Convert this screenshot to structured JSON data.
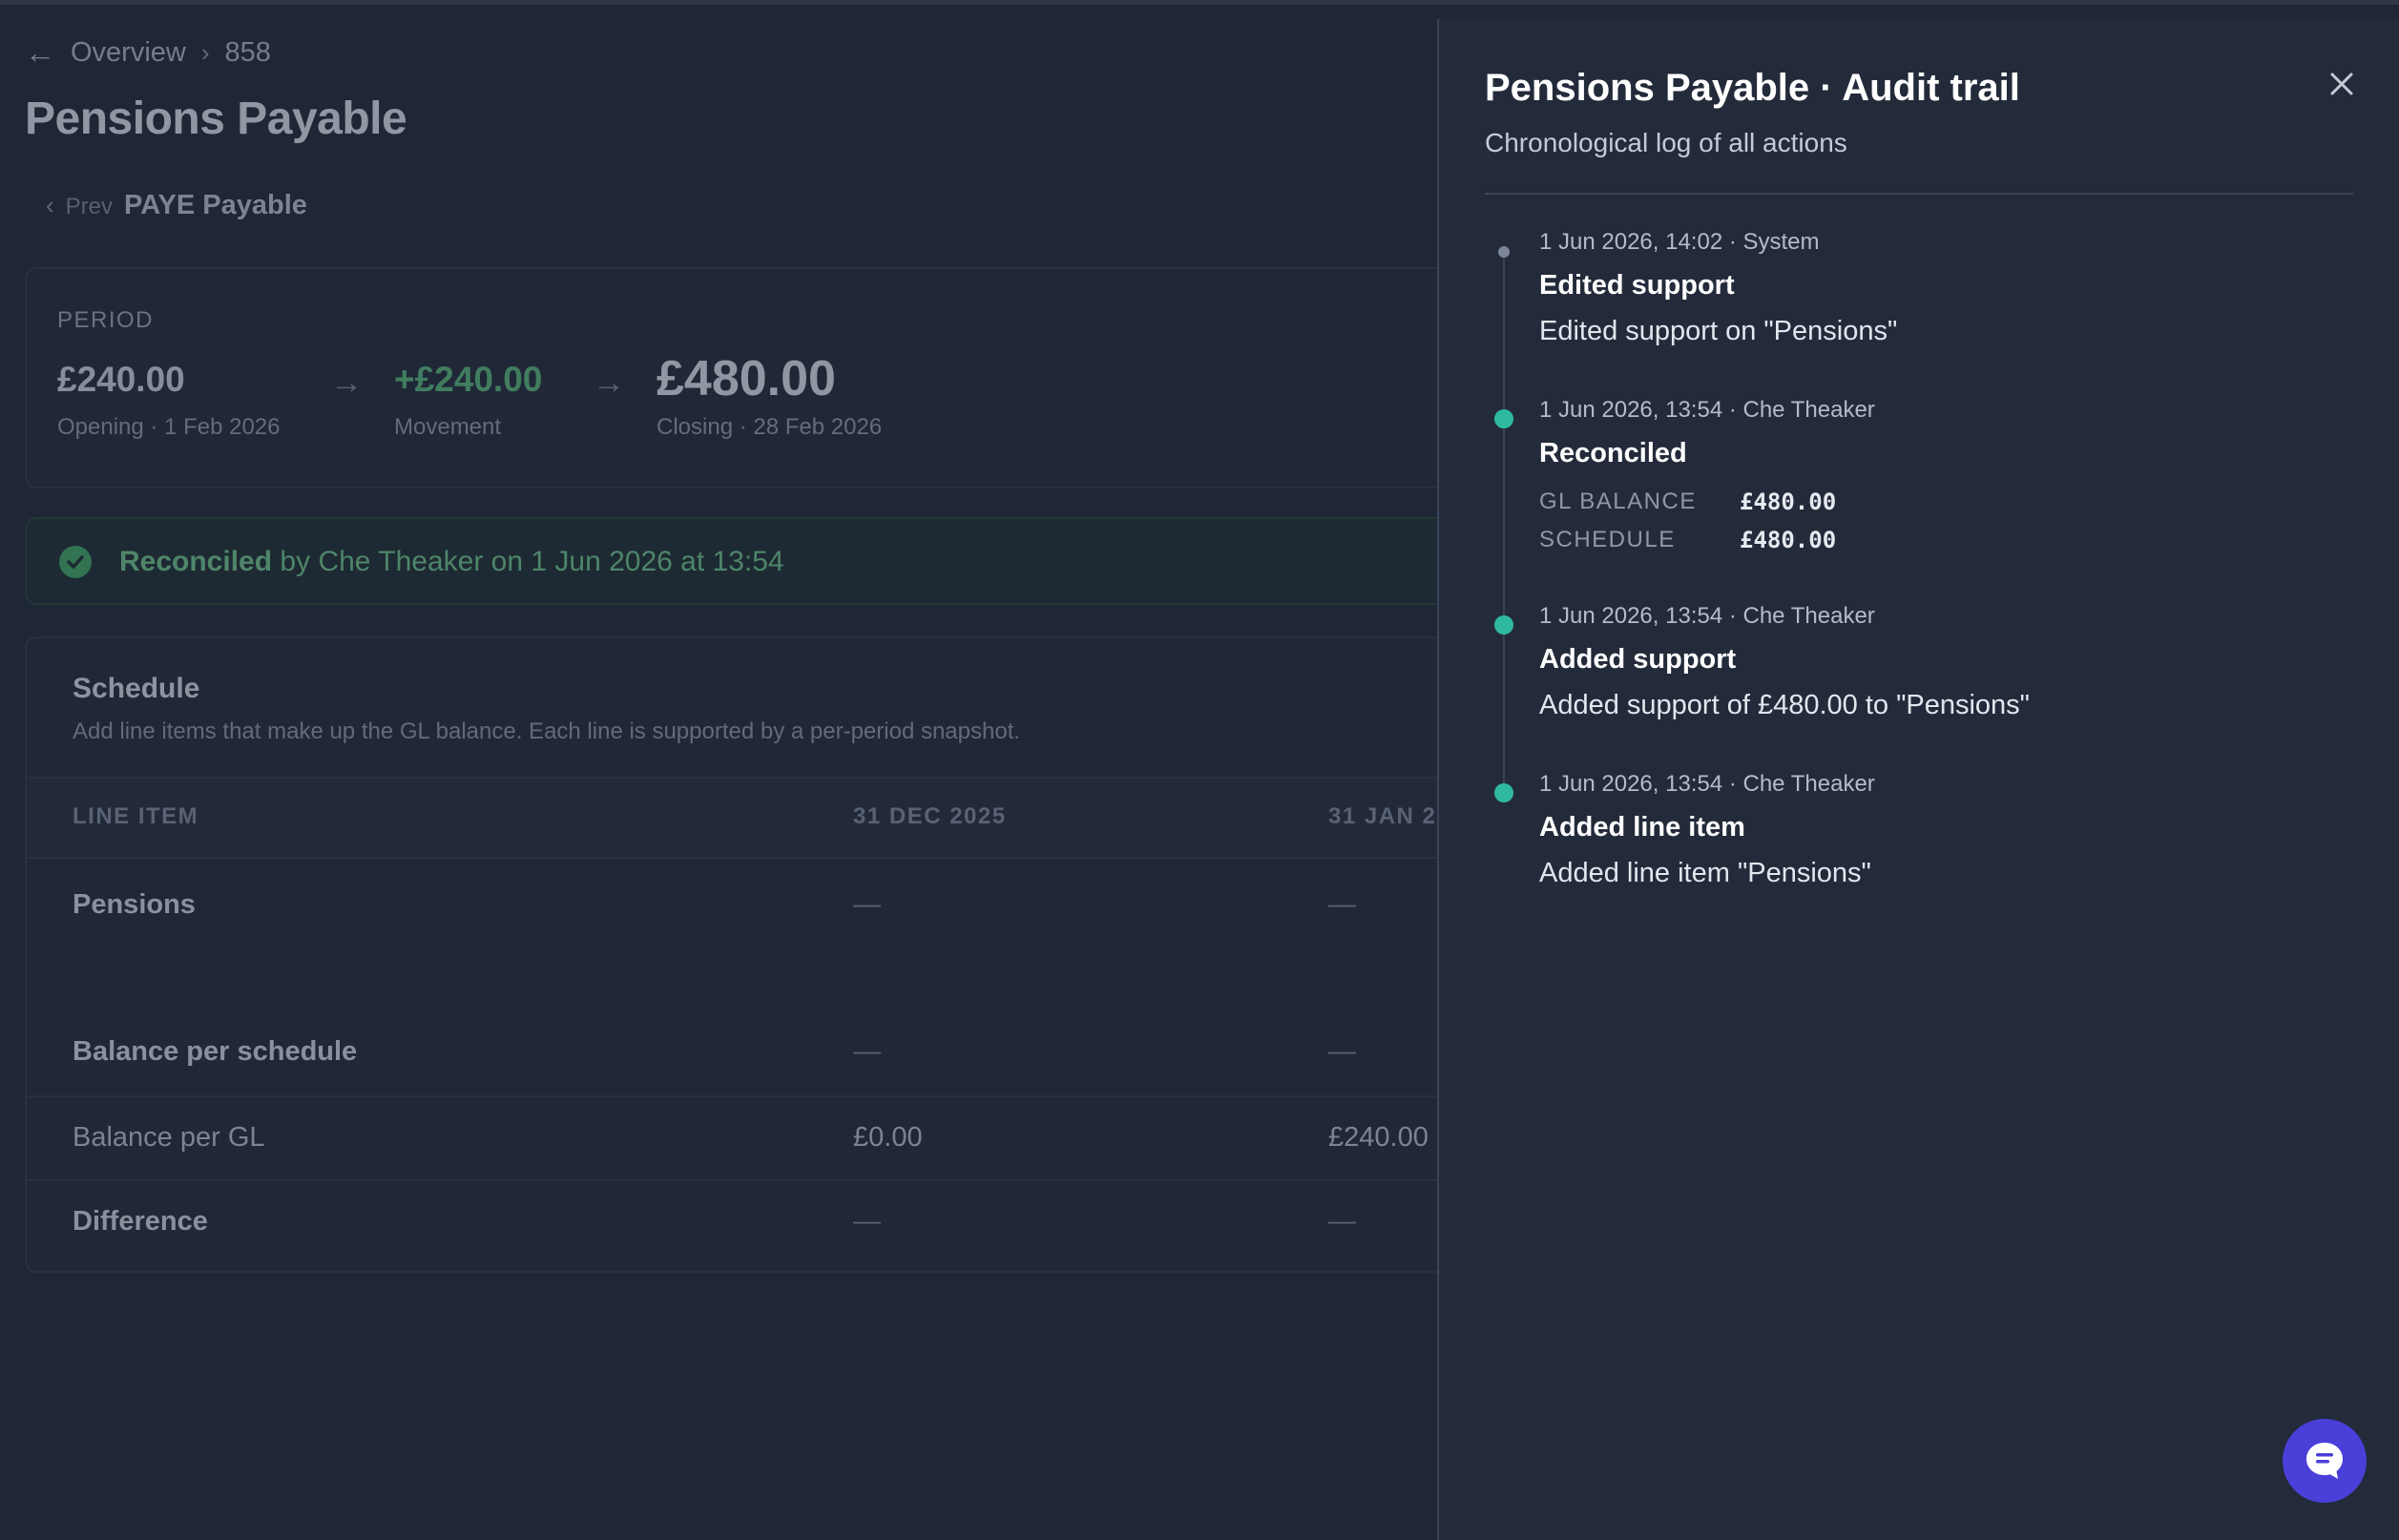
{
  "breadcrumb": {
    "back": "Overview",
    "current": "858"
  },
  "page_title": "Pensions Payable",
  "prev_nav": {
    "label": "Prev",
    "name": "PAYE Payable"
  },
  "period": {
    "label": "PERIOD",
    "opening_value": "£240.00",
    "opening_label": "Opening · 1 Feb 2026",
    "movement_value": "+£240.00",
    "movement_label": "Movement",
    "closing_value": "£480.00",
    "closing_label": "Closing · 28 Feb 2026"
  },
  "reconciled_banner": {
    "status": "Reconciled",
    "by_prefix": "by",
    "user": "Che Theaker",
    "on_text": "on 1 Jun 2026 at 13:54"
  },
  "schedule": {
    "title": "Schedule",
    "subtitle": "Add line items that make up the GL balance. Each line is supported by a per-period snapshot.",
    "columns": [
      "LINE ITEM",
      "31 DEC 2025",
      "31 JAN 2"
    ],
    "rows": [
      {
        "label": "Pensions",
        "c1": "—",
        "c2": "—"
      },
      {
        "label": "Balance per schedule",
        "c1": "—",
        "c2": "—"
      },
      {
        "label": "Balance per GL",
        "c1": "£0.00",
        "c2": "£240.00"
      },
      {
        "label": "Difference",
        "c1": "—",
        "c2": "—"
      }
    ]
  },
  "audit_panel": {
    "title": "Pensions Payable · Audit trail",
    "subtitle": "Chronological log of all actions",
    "entries": [
      {
        "meta": "1 Jun 2026, 14:02 · System",
        "title": "Edited support",
        "desc": "Edited support on \"Pensions\""
      },
      {
        "meta": "1 Jun 2026, 13:54 · Che Theaker",
        "title": "Reconciled",
        "kv": [
          {
            "k": "GL BALANCE",
            "v": "£480.00"
          },
          {
            "k": "SCHEDULE",
            "v": "£480.00"
          }
        ]
      },
      {
        "meta": "1 Jun 2026, 13:54 · Che Theaker",
        "title": "Added support",
        "desc": "Added support of £480.00 to \"Pensions\""
      },
      {
        "meta": "1 Jun 2026, 13:54 · Che Theaker",
        "title": "Added line item",
        "desc": "Added line item \"Pensions\""
      }
    ]
  },
  "colors": {
    "accent_teal": "#2fb9a1",
    "success_green": "#3fa364",
    "chat_purple": "#4a3fd8"
  },
  "icons": [
    "arrow-left-icon",
    "chevron-right-icon",
    "chevron-left-icon",
    "arrow-right-icon",
    "check-circle-icon",
    "close-icon",
    "chat-icon"
  ]
}
